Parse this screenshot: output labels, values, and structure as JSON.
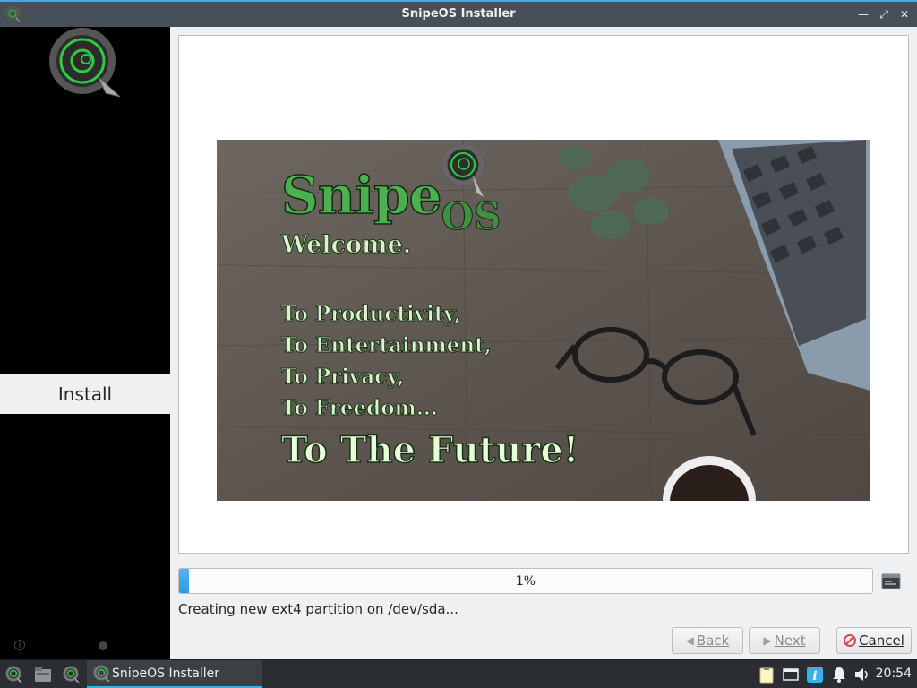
{
  "window": {
    "title": "SnipeOS Installer",
    "controls": [
      "minimize-icon",
      "maximize-icon",
      "close-icon"
    ]
  },
  "sidebar": {
    "steps": [
      {
        "label": "Install",
        "active": true
      }
    ]
  },
  "slideshow": {
    "brand": "Snipe",
    "brand_suffix": "OS",
    "welcome": "Welcome.",
    "lines": [
      "To Productivity,",
      "To Entertainment,",
      "To Privacy,",
      "To Freedom..."
    ],
    "tagline": "To The Future!"
  },
  "progress": {
    "value": 0.01,
    "label": "1%"
  },
  "status_text": "Creating new ext4 partition on /dev/sda...",
  "buttons": {
    "back": "Back",
    "next": "Next",
    "cancel": "Cancel"
  },
  "taskbar": {
    "task_label": "SnipeOS Installer",
    "clock": "20:54",
    "tray_icons": [
      "clipboard-icon",
      "display-icon",
      "info-icon",
      "bell-icon",
      "volume-icon"
    ]
  },
  "colors": {
    "accent": "#3daee9",
    "brand_green": "#4caf50",
    "cancel_red": "#da4453"
  }
}
